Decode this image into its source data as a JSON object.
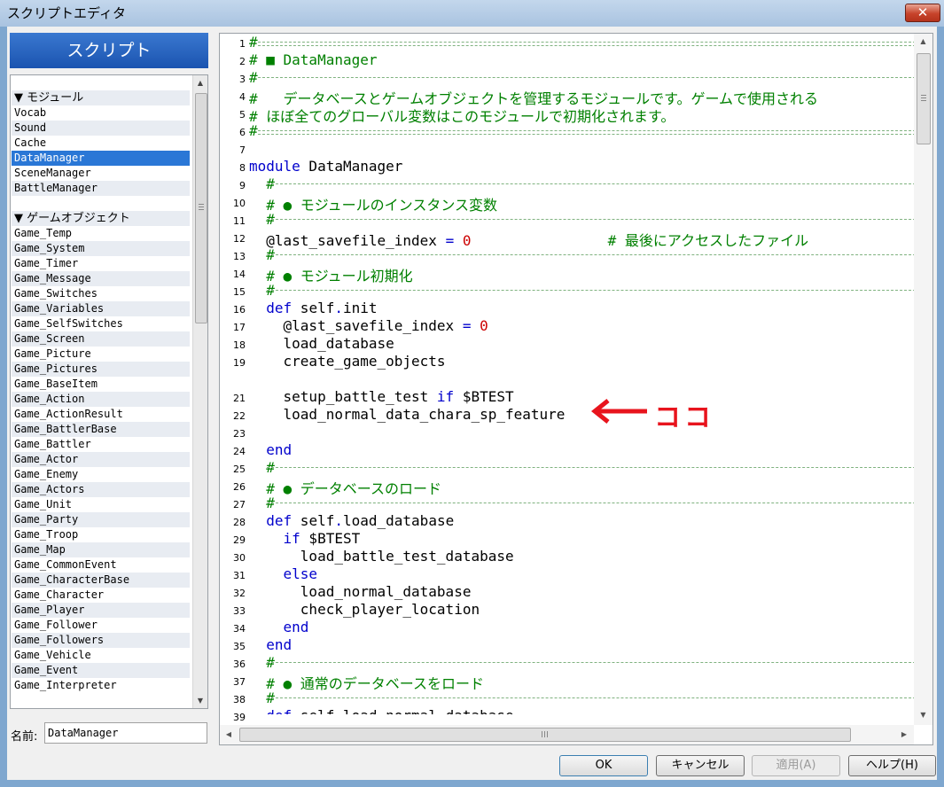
{
  "window": {
    "title": "スクリプトエディタ",
    "close_glyph": "✕"
  },
  "sidebar": {
    "header": "スクリプト",
    "items": [
      {
        "label": "▼ モジュール",
        "type": "header"
      },
      {
        "label": "Vocab"
      },
      {
        "label": "Sound"
      },
      {
        "label": "Cache"
      },
      {
        "label": "DataManager",
        "selected": true
      },
      {
        "label": "SceneManager"
      },
      {
        "label": "BattleManager"
      },
      {
        "label": "",
        "type": "blank"
      },
      {
        "label": "▼ ゲームオブジェクト",
        "type": "header"
      },
      {
        "label": "Game_Temp"
      },
      {
        "label": "Game_System"
      },
      {
        "label": "Game_Timer"
      },
      {
        "label": "Game_Message"
      },
      {
        "label": "Game_Switches"
      },
      {
        "label": "Game_Variables"
      },
      {
        "label": "Game_SelfSwitches"
      },
      {
        "label": "Game_Screen"
      },
      {
        "label": "Game_Picture"
      },
      {
        "label": "Game_Pictures"
      },
      {
        "label": "Game_BaseItem"
      },
      {
        "label": "Game_Action"
      },
      {
        "label": "Game_ActionResult"
      },
      {
        "label": "Game_BattlerBase"
      },
      {
        "label": "Game_Battler"
      },
      {
        "label": "Game_Actor"
      },
      {
        "label": "Game_Enemy"
      },
      {
        "label": "Game_Actors"
      },
      {
        "label": "Game_Unit"
      },
      {
        "label": "Game_Party"
      },
      {
        "label": "Game_Troop"
      },
      {
        "label": "Game_Map"
      },
      {
        "label": "Game_CommonEvent"
      },
      {
        "label": "Game_CharacterBase"
      },
      {
        "label": "Game_Character"
      },
      {
        "label": "Game_Player"
      },
      {
        "label": "Game_Follower"
      },
      {
        "label": "Game_Followers"
      },
      {
        "label": "Game_Vehicle"
      },
      {
        "label": "Game_Event"
      },
      {
        "label": "Game_Interpreter"
      }
    ],
    "name_label": "名前:",
    "name_value": "DataManager"
  },
  "editor": {
    "lines": [
      {
        "n": "1",
        "segs": [
          {
            "t": "#",
            "c": "cm"
          }
        ],
        "sep": "double"
      },
      {
        "n": "2",
        "segs": [
          {
            "t": "# ■ DataManager",
            "c": "cm"
          }
        ]
      },
      {
        "n": "3",
        "segs": [
          {
            "t": "#",
            "c": "cm"
          }
        ],
        "sep": "dash"
      },
      {
        "n": "4",
        "segs": [
          {
            "t": "#   データベースとゲームオブジェクトを管理するモジュールです。ゲームで使用される",
            "c": "cm"
          }
        ]
      },
      {
        "n": "5",
        "segs": [
          {
            "t": "# ほぼ全てのグローバル変数はこのモジュールで初期化されます。",
            "c": "cm"
          }
        ]
      },
      {
        "n": "6",
        "segs": [
          {
            "t": "#",
            "c": "cm"
          }
        ],
        "sep": "double"
      },
      {
        "n": "7",
        "segs": []
      },
      {
        "n": "8",
        "segs": [
          {
            "t": "module",
            "c": "kw"
          },
          {
            "t": " DataManager"
          }
        ]
      },
      {
        "n": "9",
        "segs": [
          {
            "t": "  #",
            "c": "cm"
          }
        ],
        "sep": "dash"
      },
      {
        "n": "10",
        "segs": [
          {
            "t": "  # ● モジュールのインスタンス変数",
            "c": "cm"
          }
        ]
      },
      {
        "n": "11",
        "segs": [
          {
            "t": "  #",
            "c": "cm"
          }
        ],
        "sep": "dash"
      },
      {
        "n": "12",
        "segs": [
          {
            "t": "  @last_savefile_index "
          },
          {
            "t": "=",
            "c": "kw"
          },
          {
            "t": " "
          },
          {
            "t": "0",
            "c": "num"
          },
          {
            "t": "                # 最後にアクセスしたファイル",
            "c": "cm"
          }
        ]
      },
      {
        "n": "13",
        "segs": [
          {
            "t": "  #",
            "c": "cm"
          }
        ],
        "sep": "dash"
      },
      {
        "n": "14",
        "segs": [
          {
            "t": "  # ● モジュール初期化",
            "c": "cm"
          }
        ]
      },
      {
        "n": "15",
        "segs": [
          {
            "t": "  #",
            "c": "cm"
          }
        ],
        "sep": "dash"
      },
      {
        "n": "16",
        "segs": [
          {
            "t": "  "
          },
          {
            "t": "def",
            "c": "kw"
          },
          {
            "t": " self"
          },
          {
            "t": ".",
            "c": "kw"
          },
          {
            "t": "init"
          }
        ]
      },
      {
        "n": "17",
        "segs": [
          {
            "t": "    @last_savefile_index "
          },
          {
            "t": "=",
            "c": "kw"
          },
          {
            "t": " "
          },
          {
            "t": "0",
            "c": "num"
          }
        ]
      },
      {
        "n": "18",
        "segs": [
          {
            "t": "    load_database"
          }
        ]
      },
      {
        "n": "19",
        "segs": [
          {
            "t": "    create_game_objects"
          }
        ]
      },
      {
        "n": "",
        "segs": []
      },
      {
        "n": "21",
        "segs": [
          {
            "t": "    setup_battle_test "
          },
          {
            "t": "if",
            "c": "kw"
          },
          {
            "t": " $BTEST"
          }
        ]
      },
      {
        "n": "22",
        "segs": [
          {
            "t": "    load_normal_data_chara_sp_feature"
          }
        ]
      },
      {
        "n": "23",
        "segs": []
      },
      {
        "n": "24",
        "segs": [
          {
            "t": "  "
          },
          {
            "t": "end",
            "c": "kw"
          }
        ]
      },
      {
        "n": "25",
        "segs": [
          {
            "t": "  #",
            "c": "cm"
          }
        ],
        "sep": "dash"
      },
      {
        "n": "26",
        "segs": [
          {
            "t": "  # ● データベースのロード",
            "c": "cm"
          }
        ]
      },
      {
        "n": "27",
        "segs": [
          {
            "t": "  #",
            "c": "cm"
          }
        ],
        "sep": "dash"
      },
      {
        "n": "28",
        "segs": [
          {
            "t": "  "
          },
          {
            "t": "def",
            "c": "kw"
          },
          {
            "t": " self"
          },
          {
            "t": ".",
            "c": "kw"
          },
          {
            "t": "load_database"
          }
        ]
      },
      {
        "n": "29",
        "segs": [
          {
            "t": "    "
          },
          {
            "t": "if",
            "c": "kw"
          },
          {
            "t": " $BTEST"
          }
        ]
      },
      {
        "n": "30",
        "segs": [
          {
            "t": "      load_battle_test_database"
          }
        ]
      },
      {
        "n": "31",
        "segs": [
          {
            "t": "    "
          },
          {
            "t": "else",
            "c": "kw"
          }
        ]
      },
      {
        "n": "32",
        "segs": [
          {
            "t": "      load_normal_database"
          }
        ]
      },
      {
        "n": "33",
        "segs": [
          {
            "t": "      check_player_location"
          }
        ]
      },
      {
        "n": "34",
        "segs": [
          {
            "t": "    "
          },
          {
            "t": "end",
            "c": "kw"
          }
        ]
      },
      {
        "n": "35",
        "segs": [
          {
            "t": "  "
          },
          {
            "t": "end",
            "c": "kw"
          }
        ]
      },
      {
        "n": "36",
        "segs": [
          {
            "t": "  #",
            "c": "cm"
          }
        ],
        "sep": "dash"
      },
      {
        "n": "37",
        "segs": [
          {
            "t": "  # ● 通常のデータベースをロード",
            "c": "cm"
          }
        ]
      },
      {
        "n": "38",
        "segs": [
          {
            "t": "  #",
            "c": "cm"
          }
        ],
        "sep": "dash"
      },
      {
        "n": "39",
        "segs": [
          {
            "t": "  "
          },
          {
            "t": "def",
            "c": "kw"
          },
          {
            "t": " self"
          },
          {
            "t": ".",
            "c": "kw"
          },
          {
            "t": "load_normal_database"
          }
        ]
      }
    ]
  },
  "annotation": {
    "text": "ココ",
    "color": "#e8141d"
  },
  "buttons": {
    "ok": "OK",
    "cancel": "キャンセル",
    "apply": "適用(A)",
    "help": "ヘルプ(H)"
  },
  "colors": {
    "keyword": "#0000cc",
    "comment": "#008000",
    "number": "#cc0000",
    "selection": "#2a77d6"
  }
}
